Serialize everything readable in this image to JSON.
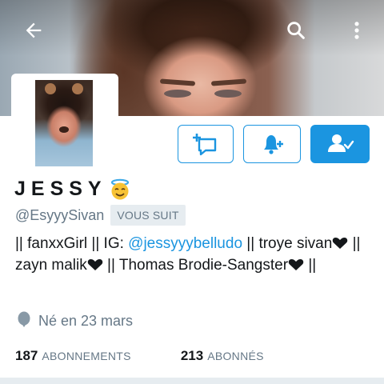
{
  "profile": {
    "display_name": "JESSY",
    "name_emoji": "smiling-face-with-halo",
    "handle": "@EsyyySivan",
    "follows_you_badge": "VOUS SUIT",
    "bio": {
      "part1": "|| fanxxGirl || IG: ",
      "link": "@jessyyybelludo",
      "part2": " || troye sivan",
      "part3": " || zayn malik",
      "part4": " || Thomas Brodie-Sangster",
      "part5": " ||"
    },
    "birthdate": "Né en 23 mars",
    "following_count": "187",
    "following_label": "ABONNEMENTS",
    "followers_count": "213",
    "followers_label": "ABONNÉS"
  },
  "toolbar": {
    "icons": [
      "back-arrow-icon",
      "search-icon",
      "more-vertical-icon"
    ]
  },
  "actions": {
    "icons": [
      "direct-message-icon",
      "notification-bell-add-icon",
      "following-user-check-icon"
    ]
  },
  "colors": {
    "accent": "#1b95e0",
    "secondary_text": "#657786",
    "primary_text": "#14171a",
    "badge_bg": "#e6ecf0"
  }
}
